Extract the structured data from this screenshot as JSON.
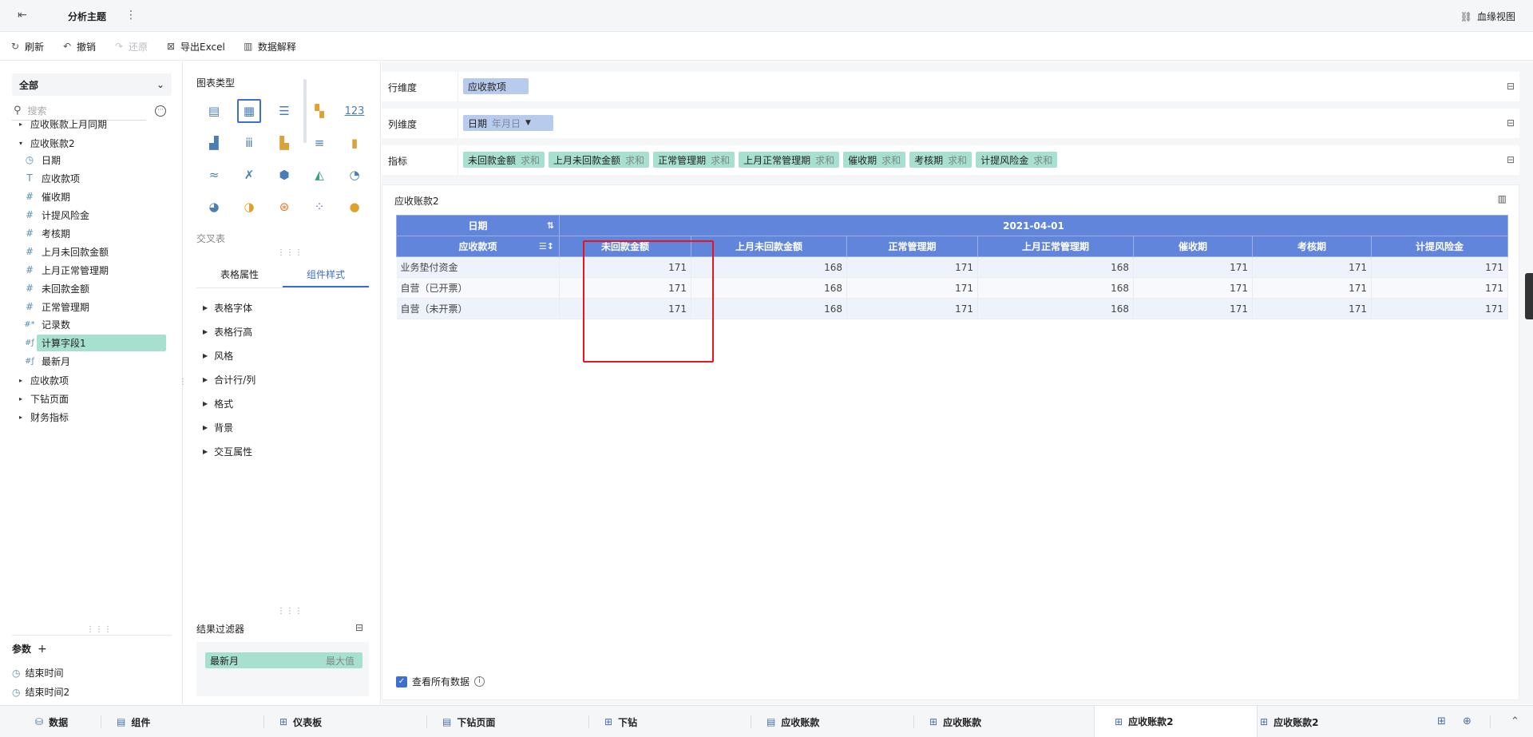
{
  "topbar": {
    "title": "分析主题",
    "lineage": "血缘视图"
  },
  "toolbar": {
    "refresh": "刷新",
    "undo": "撤销",
    "redo": "还原",
    "export": "导出Excel",
    "explain": "数据解释"
  },
  "left": {
    "select": "全部",
    "search_placeholder": "搜索",
    "tree": [
      {
        "label": "应收账款上月同期",
        "type": "group"
      },
      {
        "label": "应收账款2",
        "type": "group-open"
      },
      {
        "label": "日期",
        "type": "date"
      },
      {
        "label": "应收款项",
        "type": "text"
      },
      {
        "label": "催收期",
        "type": "num"
      },
      {
        "label": "计提风险金",
        "type": "num"
      },
      {
        "label": "考核期",
        "type": "num"
      },
      {
        "label": "上月未回款金额",
        "type": "num"
      },
      {
        "label": "上月正常管理期",
        "type": "num"
      },
      {
        "label": "未回款金额",
        "type": "num"
      },
      {
        "label": "正常管理期",
        "type": "num"
      },
      {
        "label": "记录数",
        "type": "num-star"
      },
      {
        "label": "计算字段1",
        "type": "calc"
      },
      {
        "label": "最新月",
        "type": "calc"
      },
      {
        "label": "应收款项",
        "type": "group"
      },
      {
        "label": "下钻页面",
        "type": "group"
      },
      {
        "label": "财务指标",
        "type": "group"
      }
    ],
    "params_title": "参数",
    "params": [
      "结束时间",
      "结束时间2"
    ]
  },
  "chart_panel": {
    "title": "图表类型",
    "cross_label": "交叉表",
    "tabs": [
      "表格属性",
      "组件样式"
    ],
    "active_tab": 1,
    "props": [
      "表格字体",
      "表格行高",
      "风格",
      "合计行/列",
      "格式",
      "背景",
      "交互属性"
    ],
    "result_filter": {
      "title": "结果过滤器",
      "field": "最新月",
      "agg": "最大值"
    }
  },
  "dims": {
    "row": {
      "label": "行维度",
      "chips": [
        {
          "name": "应收款项",
          "sub": ""
        }
      ]
    },
    "col": {
      "label": "列维度",
      "chips": [
        {
          "name": "日期",
          "sub": "年月日"
        }
      ]
    },
    "metric": {
      "label": "指标",
      "chips": [
        {
          "name": "未回款金额",
          "sub": "求和"
        },
        {
          "name": "上月未回款金额",
          "sub": "求和"
        },
        {
          "name": "正常管理期",
          "sub": "求和"
        },
        {
          "name": "上月正常管理期",
          "sub": "求和"
        },
        {
          "name": "催收期",
          "sub": "求和"
        },
        {
          "name": "考核期",
          "sub": "求和"
        },
        {
          "name": "计提风险金",
          "sub": "求和"
        }
      ]
    }
  },
  "canvas": {
    "title": "应收账款2",
    "table": {
      "corner_top": "日期",
      "corner_bottom": "应收款项",
      "date": "2021-04-01",
      "columns": [
        "未回款金额",
        "上月未回款金额",
        "正常管理期",
        "上月正常管理期",
        "催收期",
        "考核期",
        "计提风险金"
      ],
      "rows": [
        {
          "label": "业务垫付资金",
          "values": [
            "171",
            "168",
            "171",
            "168",
            "171",
            "171",
            "171"
          ]
        },
        {
          "label": "自营（已开票）",
          "values": [
            "171",
            "168",
            "171",
            "168",
            "171",
            "171",
            "171"
          ]
        },
        {
          "label": "自营（未开票）",
          "values": [
            "171",
            "168",
            "171",
            "168",
            "171",
            "171",
            "171"
          ]
        }
      ]
    },
    "view_all": "查看所有数据"
  },
  "bottom_tabs": [
    "数据",
    "组件",
    "仪表板",
    "下钻页面",
    "下钻",
    "应收账款",
    "应收账款",
    "应收账款2",
    "应收账款2"
  ],
  "bottom_active": 7
}
